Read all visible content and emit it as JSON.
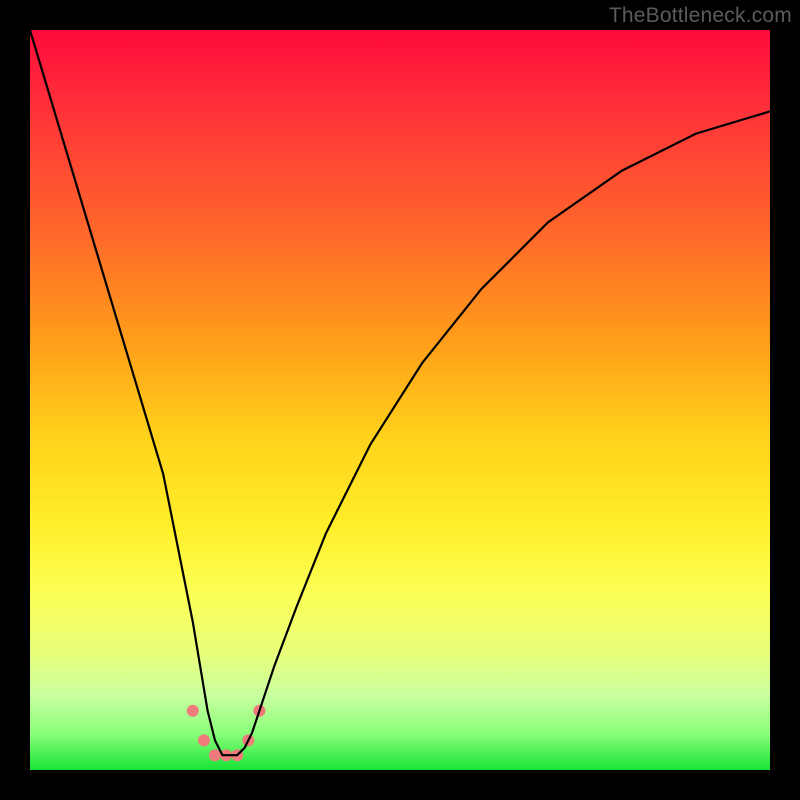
{
  "watermark": "TheBottleneck.com",
  "chart_data": {
    "type": "line",
    "title": "",
    "xlabel": "",
    "ylabel": "",
    "xlim": [
      0,
      100
    ],
    "ylim": [
      0,
      100
    ],
    "background_gradient": {
      "orientation": "vertical",
      "stops": [
        {
          "pos": 0,
          "color": "#ff0a3a"
        },
        {
          "pos": 28,
          "color": "#ff6a2a"
        },
        {
          "pos": 55,
          "color": "#ffd21a"
        },
        {
          "pos": 76,
          "color": "#fcff55"
        },
        {
          "pos": 95,
          "color": "#8cff7a"
        },
        {
          "pos": 100,
          "color": "#18e438"
        }
      ]
    },
    "series": [
      {
        "name": "bottleneck-curve",
        "color": "#000000",
        "x": [
          0,
          3,
          6,
          9,
          12,
          15,
          18,
          20,
          22,
          23,
          24,
          25,
          26,
          27,
          28,
          29,
          30,
          31,
          33,
          36,
          40,
          46,
          53,
          61,
          70,
          80,
          90,
          100
        ],
        "values": [
          100,
          90,
          80,
          70,
          60,
          50,
          40,
          30,
          20,
          14,
          8,
          4,
          2,
          2,
          2,
          3,
          5,
          8,
          14,
          22,
          32,
          44,
          55,
          65,
          74,
          81,
          86,
          89
        ]
      }
    ],
    "markers": {
      "name": "highlight-points",
      "color": "#ef7b7b",
      "radius": 6,
      "x": [
        22,
        23.5,
        25,
        26.5,
        28,
        29.5,
        31
      ],
      "values": [
        8,
        4,
        2,
        2,
        2,
        4,
        8
      ]
    }
  }
}
